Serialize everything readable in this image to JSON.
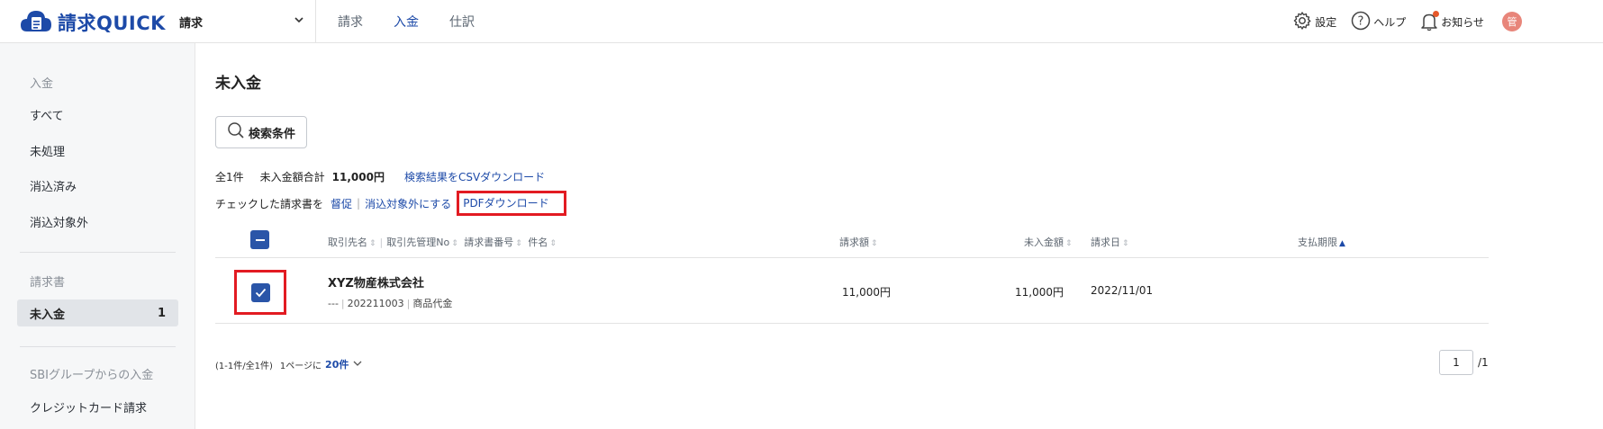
{
  "header": {
    "logo_text": "請求QUICK",
    "service": "請求",
    "nav": [
      {
        "label": "請求"
      },
      {
        "label": "入金"
      },
      {
        "label": "仕訳"
      }
    ],
    "settings_label": "設定",
    "help_label": "ヘルプ",
    "notice_label": "お知らせ",
    "avatar_text": "管"
  },
  "sidebar": {
    "section1": "入金",
    "items1": [
      {
        "label": "すべて"
      },
      {
        "label": "未処理"
      },
      {
        "label": "消込済み"
      },
      {
        "label": "消込対象外"
      }
    ],
    "section2": "請求書",
    "active_item": {
      "label": "未入金",
      "count": "1"
    },
    "section3": "SBIグループからの入金",
    "items3": [
      {
        "label": "クレジットカード請求"
      }
    ]
  },
  "main": {
    "title": "未入金",
    "search_label": "検索条件",
    "summary": {
      "count": "全1件",
      "total_label": "未入金額合計",
      "total_value": "11,000円",
      "csv_link": "検索結果をCSVダウンロード"
    },
    "actions": {
      "prefix": "チェックした請求書を",
      "remind": "督促",
      "exclude": "消込対象外にする",
      "pdf": "PDFダウンロード"
    },
    "table": {
      "headers": {
        "client": "取引先名",
        "client_no": "取引先管理No",
        "invoice_no": "請求書番号",
        "subject": "件名",
        "amount": "請求額",
        "unpaid": "未入金額",
        "date": "請求日",
        "due": "支払期限"
      },
      "rows": [
        {
          "client": "XYZ物産株式会社",
          "client_no": "---",
          "invoice_no": "202211003",
          "subject": "商品代金",
          "amount": "11,000円",
          "unpaid": "11,000円",
          "date": "2022/11/01"
        }
      ]
    },
    "pager": {
      "range": "(1-1件/全1件)",
      "per_label": "1ページに",
      "per_value": "20件",
      "page": "1",
      "total": "/1"
    }
  }
}
